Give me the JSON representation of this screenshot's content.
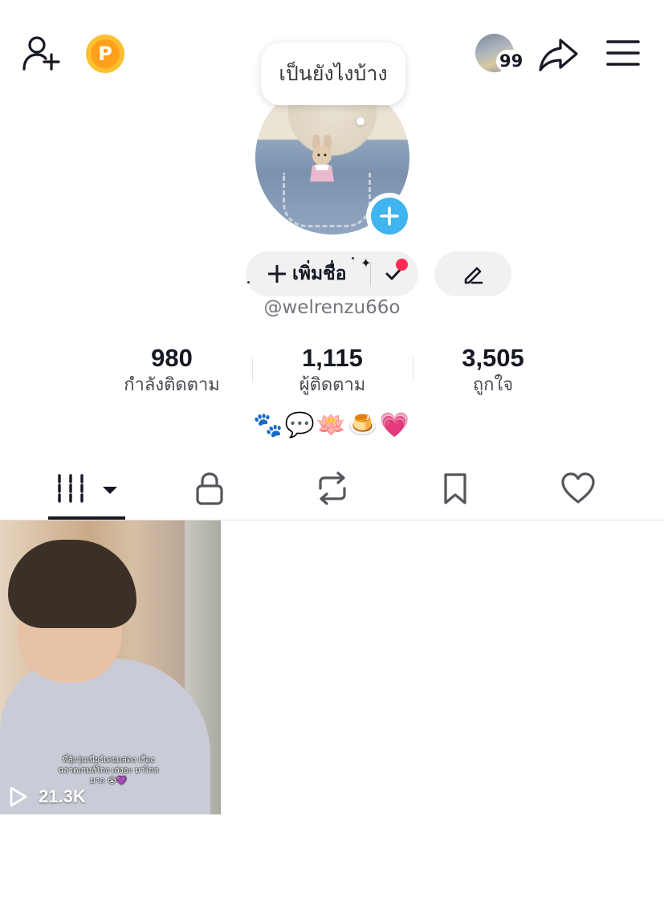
{
  "header": {
    "add_friend_icon": "add-user-icon",
    "coin_letter": "P",
    "notification_count": "99",
    "share_icon": "share-arrow-icon",
    "menu_icon": "hamburger-icon"
  },
  "profile": {
    "status_bubble": "เป็นยังไงบ้าง",
    "add_name_label": "เพิ่มชื่อ",
    "handle": "@welrenzu66o",
    "bio": "🐾💬🪷🍮💗"
  },
  "stats": [
    {
      "value": "980",
      "label": "กำลังติดตาม"
    },
    {
      "value": "1,115",
      "label": "ผู้ติดตาม"
    },
    {
      "value": "3,505",
      "label": "ถูกใจ"
    }
  ],
  "tabs": [
    {
      "icon": "grid-icon",
      "active": true
    },
    {
      "icon": "lock-icon"
    },
    {
      "icon": "repost-icon"
    },
    {
      "icon": "bookmark-icon"
    },
    {
      "icon": "heart-icon"
    }
  ],
  "videos": [
    {
      "views": "21.3K",
      "caption": "พี่สุ้งวุ่นเนียร์เคยแสดง เรื่อง ฉลาดเกมส์โกง เก่งอะ มาไกลมาก 😭💜"
    }
  ],
  "colors": {
    "accent_blue": "#3fb4ee",
    "notification_red": "#fe2c55",
    "coin_gold": "#fbc02d"
  }
}
